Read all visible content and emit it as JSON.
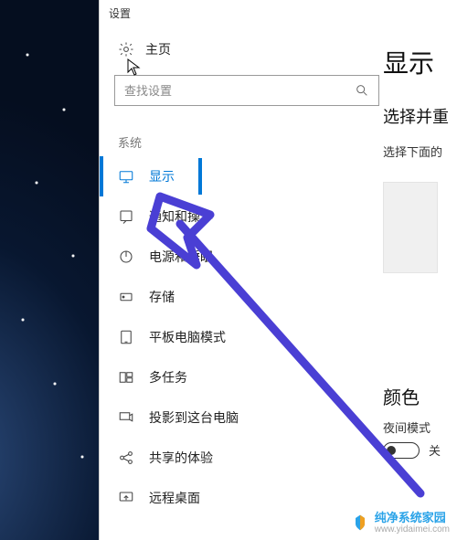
{
  "window": {
    "title": "设置"
  },
  "sidebar": {
    "home_label": "主页",
    "search_placeholder": "查找设置",
    "category_label": "系统",
    "items": [
      {
        "label": "显示",
        "icon": "display-icon",
        "selected": true
      },
      {
        "label": "通知和操作",
        "icon": "notification-icon",
        "selected": false
      },
      {
        "label": "电源和睡眠",
        "icon": "power-icon",
        "selected": false
      },
      {
        "label": "存储",
        "icon": "storage-icon",
        "selected": false
      },
      {
        "label": "平板电脑模式",
        "icon": "tablet-icon",
        "selected": false
      },
      {
        "label": "多任务",
        "icon": "multitask-icon",
        "selected": false
      },
      {
        "label": "投影到这台电脑",
        "icon": "project-icon",
        "selected": false
      },
      {
        "label": "共享的体验",
        "icon": "share-icon",
        "selected": false
      },
      {
        "label": "远程桌面",
        "icon": "remote-icon",
        "selected": false
      }
    ]
  },
  "content": {
    "heading": "显示",
    "sub_heading": "选择并重",
    "sub_text": "选择下面的",
    "color_heading": "颜色",
    "night_mode_label": "夜间模式",
    "night_mode_state": "关"
  },
  "annotation": {
    "arrow_color": "#4a3fd4"
  },
  "watermark": {
    "name": "纯净系统家园",
    "url": "www.yidaimei.com"
  }
}
